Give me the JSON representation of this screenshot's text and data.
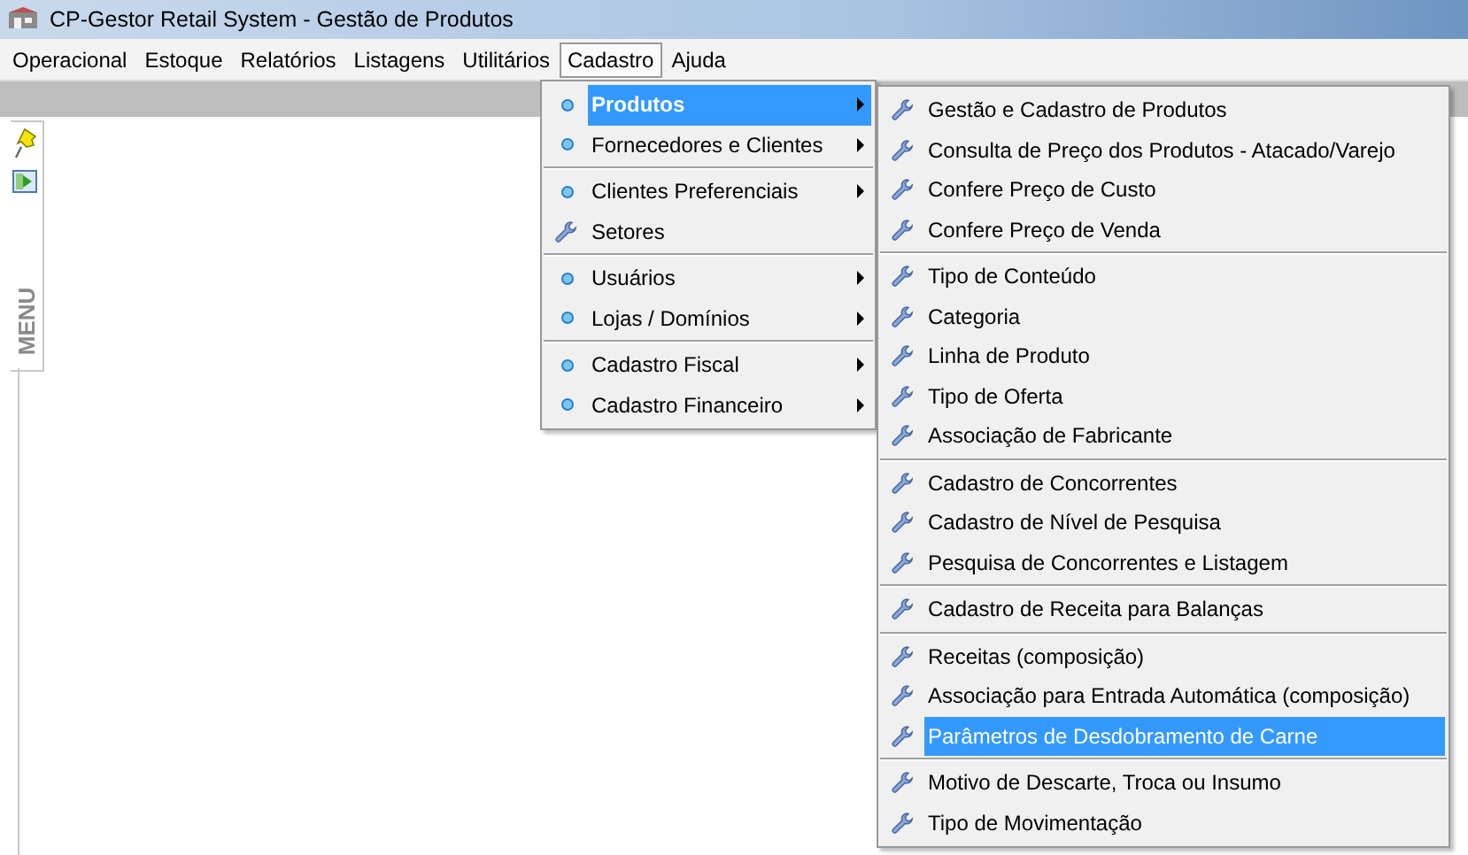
{
  "window": {
    "title": "CP-Gestor Retail System - Gestão de Produtos"
  },
  "menubar": [
    {
      "label": "Operacional",
      "selected": false
    },
    {
      "label": "Estoque",
      "selected": false
    },
    {
      "label": "Relatórios",
      "selected": false
    },
    {
      "label": "Listagens",
      "selected": false
    },
    {
      "label": "Utilitários",
      "selected": false
    },
    {
      "label": "Cadastro",
      "selected": true
    },
    {
      "label": "Ajuda",
      "selected": false
    }
  ],
  "side_panel": {
    "label": "MENU"
  },
  "dropdown": {
    "sections": [
      [
        {
          "kind": "submenu",
          "label": "Produtos",
          "selected": true
        },
        {
          "kind": "submenu",
          "label": "Fornecedores e Clientes",
          "selected": false
        }
      ],
      [
        {
          "kind": "submenu",
          "label": "Clientes Preferenciais",
          "selected": false
        },
        {
          "kind": "command",
          "label": "Setores",
          "selected": false
        }
      ],
      [
        {
          "kind": "submenu",
          "label": "Usuários",
          "selected": false
        },
        {
          "kind": "submenu",
          "label": "Lojas / Domínios",
          "selected": false
        }
      ],
      [
        {
          "kind": "submenu",
          "label": "Cadastro Fiscal",
          "selected": false
        },
        {
          "kind": "submenu",
          "label": "Cadastro Financeiro",
          "selected": false
        }
      ]
    ]
  },
  "submenu": {
    "sections": [
      [
        {
          "kind": "command",
          "label": "Gestão e Cadastro de Produtos",
          "selected": false
        },
        {
          "kind": "command",
          "label": "Consulta de Preço dos Produtos - Atacado/Varejo",
          "selected": false
        },
        {
          "kind": "command",
          "label": "Confere Preço de Custo",
          "selected": false
        },
        {
          "kind": "command",
          "label": "Confere Preço de Venda",
          "selected": false
        }
      ],
      [
        {
          "kind": "command",
          "label": "Tipo de Conteúdo",
          "selected": false
        },
        {
          "kind": "command",
          "label": "Categoria",
          "selected": false
        },
        {
          "kind": "command",
          "label": "Linha de Produto",
          "selected": false
        },
        {
          "kind": "command",
          "label": "Tipo de Oferta",
          "selected": false
        },
        {
          "kind": "command",
          "label": "Associação de Fabricante",
          "selected": false
        }
      ],
      [
        {
          "kind": "command",
          "label": "Cadastro de Concorrentes",
          "selected": false
        },
        {
          "kind": "command",
          "label": "Cadastro de Nível de Pesquisa",
          "selected": false
        },
        {
          "kind": "command",
          "label": "Pesquisa de Concorrentes e Listagem",
          "selected": false
        }
      ],
      [
        {
          "kind": "command",
          "label": "Cadastro de Receita para Balanças",
          "selected": false
        }
      ],
      [
        {
          "kind": "command",
          "label": "Receitas (composição)",
          "selected": false
        },
        {
          "kind": "command",
          "label": "Associação para Entrada Automática (composição)",
          "selected": false
        },
        {
          "kind": "command",
          "label": "Parâmetros de Desdobramento de Carne",
          "selected": true
        }
      ],
      [
        {
          "kind": "command",
          "label": "Motivo de Descarte, Troca ou Insumo",
          "selected": false
        },
        {
          "kind": "command",
          "label": "Tipo de Movimentação",
          "selected": false
        }
      ]
    ]
  }
}
